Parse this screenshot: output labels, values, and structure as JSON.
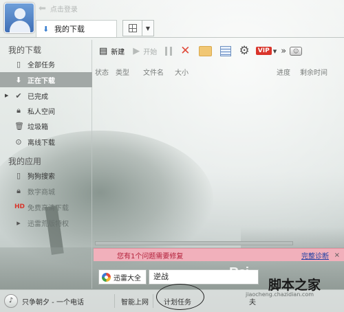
{
  "header": {
    "login_text": "点击登录",
    "tab_label": "我的下载"
  },
  "sidebar": {
    "my_downloads_title": "我的下载",
    "download_items": [
      {
        "label": "全部任务",
        "icon": "page-icon"
      },
      {
        "label": "正在下载",
        "icon": "download-arrow-icon",
        "active": true
      },
      {
        "label": "已完成",
        "icon": "check-icon"
      },
      {
        "label": "私人空间",
        "icon": "lock-icon"
      },
      {
        "label": "垃圾箱",
        "icon": "trash-icon"
      },
      {
        "label": "离线下载",
        "icon": "offline-download-icon"
      }
    ],
    "my_apps_title": "我的应用",
    "app_items": [
      {
        "label": "狗狗搜索",
        "icon": "search-page-icon"
      },
      {
        "label": "数字商城",
        "icon": "lock-icon"
      },
      {
        "label": "免费高清下载",
        "icon": "hd-icon"
      },
      {
        "label": "迅雷荒版特权",
        "icon": "play-icon"
      }
    ]
  },
  "toolbar": {
    "new_label": "新建",
    "start_label": "开始",
    "vip_label": "VIP"
  },
  "columns": {
    "status": "状态",
    "type": "类型",
    "filename": "文件名",
    "size": "大小",
    "progress": "进度",
    "remaining": "剩余时间"
  },
  "notice": {
    "message": "您有1个问题需要修复",
    "action": "完整诊断",
    "close": "×"
  },
  "search": {
    "button_label": "迅雷大全",
    "value": "逆战"
  },
  "statusbar": {
    "music_text": "只争朝夕 - 一个电话",
    "smart_net": "智能上网",
    "scheduled_task": "计划任务",
    "more_text": "夫"
  },
  "watermark": {
    "baidu": "Bai",
    "site": "脚本之家",
    "url": "jiaocheng.chazidian.com"
  },
  "colors": {
    "active_item_bg": "#a2a8a6",
    "notice_bg": "#f1b0bb",
    "notice_text": "#b3203a",
    "delete_red": "#e04a3a"
  }
}
